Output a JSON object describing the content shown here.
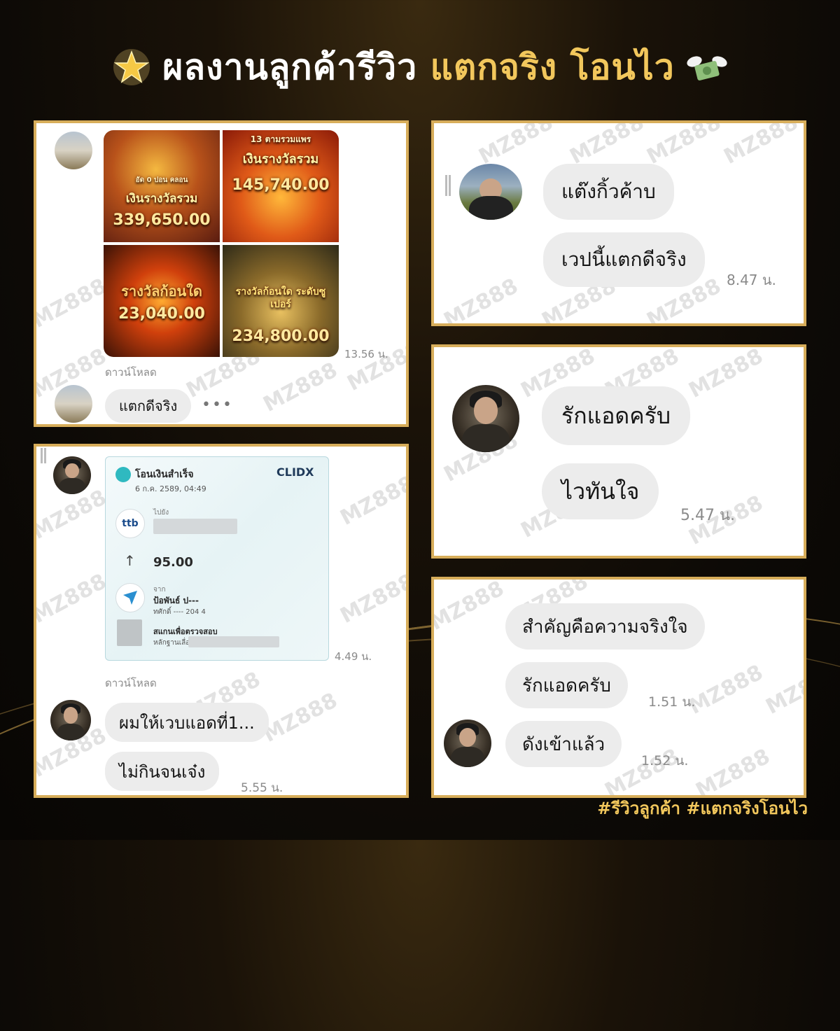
{
  "header": {
    "title_white": "ผลงานลูกค้ารีวิว",
    "title_gold": "แตกจริง โอนไว",
    "star_icon": "star-icon",
    "money_icon": "winged-money-icon"
  },
  "watermark": "MZ888",
  "panel1": {
    "tiles": [
      {
        "caption": "เงินรางวัลรวม",
        "value": "339,650.00",
        "top_text": "อัด 0 ปอน คลอน"
      },
      {
        "caption": "เงินรางวัลรวม",
        "value": "145,740.00",
        "top_text": "13 ตามรวมแพร"
      },
      {
        "caption": "รางวัลก้อนใด",
        "value": "23,040.00"
      },
      {
        "caption": "รางวัลก้อนใด ระดับซูเปอร์",
        "value": "234,800.00"
      }
    ],
    "time1": "13.56 น.",
    "download_label": "ดาวน์โหลด",
    "message": "แตกดีจริง",
    "more": "•••"
  },
  "panel2": {
    "messages": [
      "แต๊งกิ้วค้าบ",
      "เวปนี้แตกดีจริง"
    ],
    "time": "8.47 น."
  },
  "panel3": {
    "receipt": {
      "status": "โอนเงินสำเร็จ",
      "datetime": "6 ก.ค. 2589, 04:49",
      "brand": "CLIDX",
      "to_label": "ไปยัง",
      "bank_logo": "ttb",
      "amount": "95.00",
      "from_label": "จาก",
      "sender": "ป้อพันธ์ ป---",
      "sender_acct": "ทศักดิ์ ---- 204 4",
      "scan_label": "สแกนเพื่อตรวจสอบ",
      "ref_label": "หลักฐานเลื่อ"
    },
    "time1": "4.49 น.",
    "download_label": "ดาวน์โหลด",
    "messages": [
      "ผมให้เวบแอดที่1...",
      "ไม่กินจนเจ๋ง"
    ],
    "time2": "5.55 น."
  },
  "panel4": {
    "messages": [
      "รักแอดครับ",
      "ไวทันใจ"
    ],
    "time": "5.47 น."
  },
  "panel5": {
    "messages": [
      "สำคัญคือความจริงใจ",
      "รักแอดครับ",
      "ดังเข้าแล้ว"
    ],
    "time1": "1.51 น.",
    "time2": "1.52 น."
  },
  "footer": {
    "tags": "#รีวิวลูกค้า #แตกจริงโอนไว"
  },
  "colors": {
    "gold": "#f2c75c",
    "panel_border": "#d7ad5a",
    "bubble": "#ececec"
  }
}
